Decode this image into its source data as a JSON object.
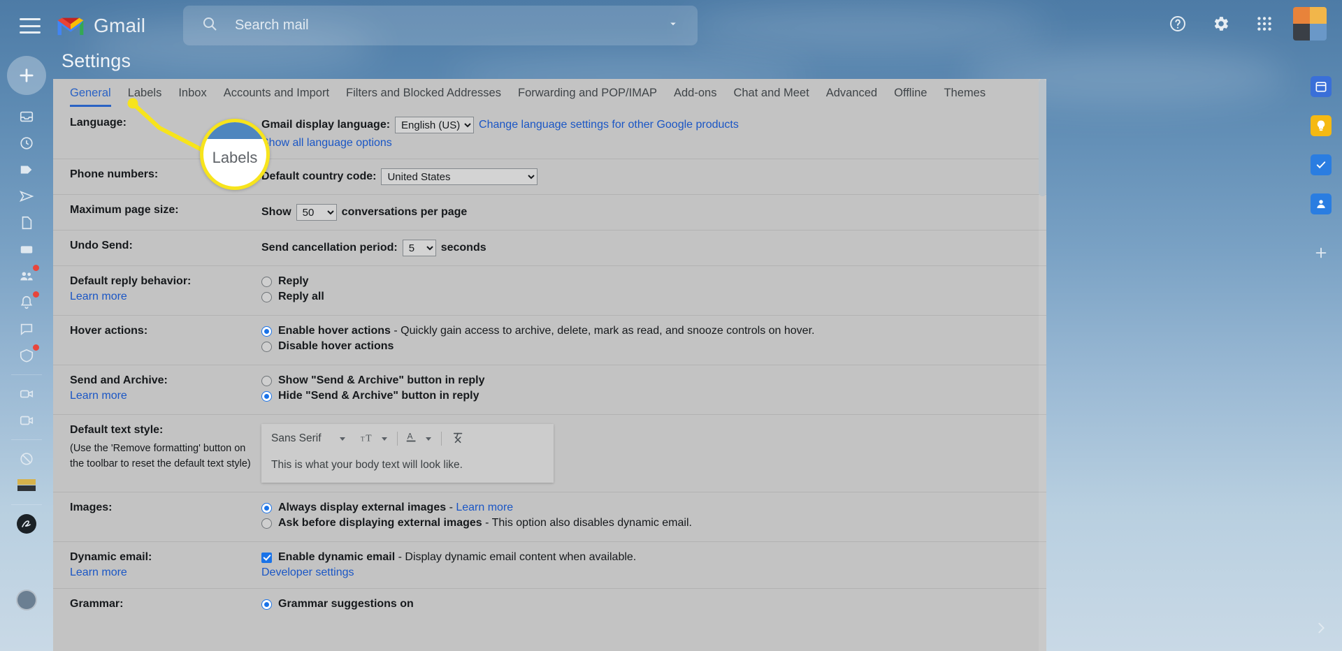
{
  "header": {
    "menu_icon": "hamburger-icon",
    "brand": "Gmail",
    "search": {
      "placeholder": "Search mail",
      "value": "",
      "icon": "search-icon",
      "options_icon": "chevron-down-icon"
    },
    "help_icon": "help-icon",
    "settings_icon": "gear-icon",
    "apps_icon": "apps-grid-icon"
  },
  "left_rail": {
    "compose_label": "+",
    "items": [
      {
        "name": "inbox-icon",
        "badge": false
      },
      {
        "name": "snoozed-clock-icon",
        "badge": false
      },
      {
        "name": "label-tag-icon",
        "badge": false
      },
      {
        "name": "sent-icon",
        "badge": false
      },
      {
        "name": "drafts-icon",
        "badge": false
      },
      {
        "name": "categories-icon",
        "badge": false
      },
      {
        "name": "social-people-icon",
        "badge": true
      },
      {
        "name": "notifications-icon",
        "badge": true
      },
      {
        "name": "chat-bubble-icon",
        "badge": false
      },
      {
        "name": "promotions-tag-icon",
        "badge": true
      },
      {
        "name": "meet-camera-icon",
        "badge": false
      },
      {
        "name": "video-icon",
        "badge": false
      },
      {
        "name": "spam-icon",
        "badge": false
      },
      {
        "name": "theme-swatch-icon",
        "badge": false
      },
      {
        "name": "signature-pen-icon",
        "badge": false
      }
    ]
  },
  "right_rail": {
    "items": [
      {
        "name": "calendar-icon",
        "color": "#3a6fd8"
      },
      {
        "name": "keep-icon",
        "color": "#f5b912"
      },
      {
        "name": "tasks-icon",
        "color": "#2a7de1"
      },
      {
        "name": "contacts-icon",
        "color": "#2a7de1"
      }
    ],
    "add_icon": "plus-icon",
    "expand_icon": "chevron-right-icon"
  },
  "page": {
    "title": "Settings",
    "tabs": [
      {
        "label": "General",
        "active": true
      },
      {
        "label": "Labels",
        "active": false
      },
      {
        "label": "Inbox",
        "active": false
      },
      {
        "label": "Accounts and Import",
        "active": false
      },
      {
        "label": "Filters and Blocked Addresses",
        "active": false
      },
      {
        "label": "Forwarding and POP/IMAP",
        "active": false
      },
      {
        "label": "Add-ons",
        "active": false
      },
      {
        "label": "Chat and Meet",
        "active": false
      },
      {
        "label": "Advanced",
        "active": false
      },
      {
        "label": "Offline",
        "active": false
      },
      {
        "label": "Themes",
        "active": false
      }
    ]
  },
  "settings": {
    "language": {
      "label": "Language:",
      "display_language_label": "Gmail display language:",
      "display_language_value": "English (US)",
      "change_link": "Change language settings for other Google products",
      "show_all_link": "Show all language options"
    },
    "phone_numbers": {
      "label": "Phone numbers:",
      "country_code_label": "Default country code:",
      "country_code_value": "United States"
    },
    "max_page_size": {
      "label": "Maximum page size:",
      "show_word": "Show",
      "value": "50",
      "suffix": "conversations per page"
    },
    "undo_send": {
      "label": "Undo Send:",
      "period_label": "Send cancellation period:",
      "value": "5",
      "suffix": "seconds"
    },
    "default_reply": {
      "label": "Default reply behavior:",
      "learn_more": "Learn more",
      "options": [
        {
          "text": "Reply",
          "selected": false
        },
        {
          "text": "Reply all",
          "selected": false
        }
      ]
    },
    "hover_actions": {
      "label": "Hover actions:",
      "options": [
        {
          "bold": "Enable hover actions",
          "rest": " - Quickly gain access to archive, delete, mark as read, and snooze controls on hover.",
          "selected": true
        },
        {
          "bold": "Disable hover actions",
          "rest": "",
          "selected": false
        }
      ]
    },
    "send_and_archive": {
      "label": "Send and Archive:",
      "learn_more": "Learn more",
      "options": [
        {
          "text": "Show \"Send & Archive\" button in reply",
          "selected": false
        },
        {
          "text": "Hide \"Send & Archive\" button in reply",
          "selected": true
        }
      ]
    },
    "default_text_style": {
      "label": "Default text style:",
      "note": "(Use the 'Remove formatting' button on the toolbar to reset the default text style)",
      "font_value": "Sans Serif",
      "size_icon": "text-size-icon",
      "color_icon": "text-color-icon",
      "remove_format_icon": "remove-formatting-icon",
      "sample_text": "This is what your body text will look like."
    },
    "images": {
      "label": "Images:",
      "options": [
        {
          "bold": "Always display external images",
          "rest": " - ",
          "link": "Learn more",
          "selected": true
        },
        {
          "bold": "Ask before displaying external images",
          "rest": " - This option also disables dynamic email.",
          "link": "",
          "selected": false
        }
      ]
    },
    "dynamic_email": {
      "label": "Dynamic email:",
      "learn_more": "Learn more",
      "checkbox_bold": "Enable dynamic email",
      "checkbox_rest": " - Display dynamic email content when available.",
      "checked": true,
      "developer_link": "Developer settings"
    },
    "grammar": {
      "label": "Grammar:",
      "option_text": "Grammar suggestions on",
      "selected": true
    }
  },
  "annotation": {
    "callout_text": "Labels",
    "highlight_color": "#f7e41c",
    "target_tab": "Labels"
  }
}
